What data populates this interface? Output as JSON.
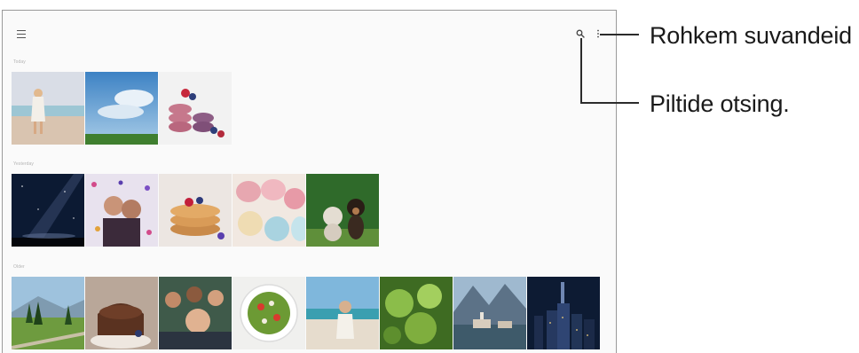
{
  "toolbar": {
    "menu_icon": "hamburger-icon",
    "search_icon": "search-icon",
    "more_icon": "more-vertical-icon"
  },
  "sections": [
    {
      "label": "Today",
      "thumbnails": [
        "girl-on-beach",
        "blue-sky-clouds",
        "berry-macarons"
      ]
    },
    {
      "label": "Yesterday",
      "thumbnails": [
        "milky-way-night",
        "confetti-couple",
        "pancakes-berries",
        "pastel-macarons",
        "kitten-and-puppy"
      ]
    },
    {
      "label": "Older",
      "thumbnails": [
        "meadow-trees",
        "chocolate-cake",
        "group-selfie",
        "salad-bowl",
        "beach-child",
        "green-leaves",
        "mountain-village",
        "city-night"
      ]
    }
  ],
  "callouts": {
    "more_options": "Rohkem suvandeid",
    "search_images": "Piltide otsing."
  }
}
